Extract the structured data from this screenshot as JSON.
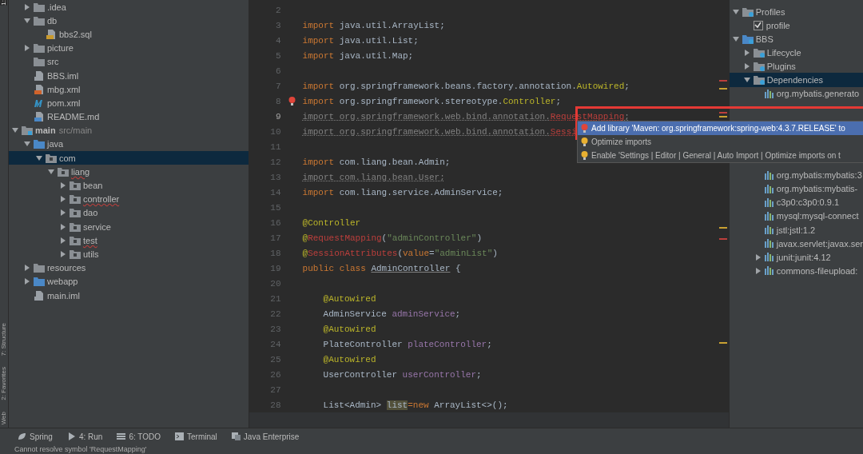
{
  "left_stripe": [
    {
      "label": "1:",
      "selected": true
    },
    {
      "label": "7: Structure",
      "selected": false
    },
    {
      "label": "2: Favorites",
      "selected": false
    },
    {
      "label": "Web",
      "selected": false
    }
  ],
  "project_tree": {
    "upper_items": [
      {
        "label": ".idea",
        "kind": "folder",
        "expanded": false,
        "selected": false
      },
      {
        "label": "db",
        "kind": "folder",
        "expanded": true,
        "selected": false,
        "children": [
          {
            "label": "bbs2.sql",
            "kind": "sql",
            "selected": false
          }
        ]
      },
      {
        "label": "picture",
        "kind": "folder",
        "expanded": false,
        "selected": false
      },
      {
        "label": "src",
        "kind": "folder",
        "selected": false
      },
      {
        "label": "BBS.iml",
        "kind": "iml",
        "selected": false
      },
      {
        "label": "mbg.xml",
        "kind": "xml",
        "selected": false
      },
      {
        "label": "pom.xml",
        "kind": "maven",
        "selected": false
      },
      {
        "label": "README.md",
        "kind": "md",
        "selected": false
      }
    ],
    "items": [
      {
        "label": "main",
        "note": "src/main",
        "kind": "module",
        "expanded": true,
        "selected": false,
        "children": [
          {
            "label": "java",
            "kind": "source",
            "expanded": true,
            "selected": false,
            "children": [
              {
                "label": "com",
                "kind": "package",
                "expanded": true,
                "selected": true,
                "children": [
                  {
                    "label": "liang",
                    "kind": "package",
                    "expanded": true,
                    "selected": false,
                    "error": true,
                    "children": [
                      {
                        "label": "bean",
                        "kind": "package",
                        "expanded": false,
                        "selected": false,
                        "error": false
                      },
                      {
                        "label": "controller",
                        "kind": "package",
                        "expanded": false,
                        "selected": false,
                        "error": true
                      },
                      {
                        "label": "dao",
                        "kind": "package",
                        "expanded": false,
                        "selected": false,
                        "error": false
                      },
                      {
                        "label": "service",
                        "kind": "package",
                        "expanded": false,
                        "selected": false,
                        "error": false
                      },
                      {
                        "label": "test",
                        "kind": "package",
                        "expanded": false,
                        "selected": false,
                        "error": true
                      },
                      {
                        "label": "utils",
                        "kind": "package",
                        "expanded": false,
                        "selected": false,
                        "error": false
                      }
                    ]
                  }
                ]
              }
            ]
          },
          {
            "label": "resources",
            "kind": "folder",
            "expanded": false,
            "selected": false
          },
          {
            "label": "webapp",
            "kind": "web",
            "expanded": false,
            "selected": false
          },
          {
            "label": "main.iml",
            "kind": "iml",
            "selected": false
          }
        ]
      }
    ]
  },
  "editor": {
    "lines": [
      {
        "number": "2"
      },
      {
        "number": "3",
        "code": [
          {
            "t": "import",
            "kind": "keyword"
          },
          {
            "t": " java.util.ArrayList;",
            "kind": "plain"
          }
        ]
      },
      {
        "number": "4",
        "code": [
          {
            "t": "import",
            "kind": "keyword"
          },
          {
            "t": " java.util.List;",
            "kind": "plain"
          }
        ]
      },
      {
        "number": "5",
        "code": [
          {
            "t": "import",
            "kind": "keyword"
          },
          {
            "t": " java.util.Map;",
            "kind": "plain"
          }
        ]
      },
      {
        "number": "6"
      },
      {
        "number": "7",
        "code": [
          {
            "t": "import",
            "kind": "keyword"
          },
          {
            "t": " org.springframework.beans.factory.annotation.",
            "kind": "plain"
          },
          {
            "t": "Autowired",
            "kind": "annotation"
          },
          {
            "t": ";",
            "kind": "plain"
          }
        ]
      },
      {
        "number": "8",
        "bulb": true,
        "code": [
          {
            "t": "import",
            "kind": "keyword"
          },
          {
            "t": " org.springframework.stereotype.",
            "kind": "plain"
          },
          {
            "t": "Controller",
            "kind": "annotation"
          },
          {
            "t": ";",
            "kind": "plain"
          }
        ]
      },
      {
        "number": "9",
        "current": true,
        "code": [
          {
            "t": "import org.springframework.web.bind.annotation.",
            "kind": "unused"
          },
          {
            "t": "RequestMapping",
            "kind": "unresolved"
          },
          {
            "t": ";",
            "kind": "unused"
          }
        ]
      },
      {
        "number": "10",
        "code": [
          {
            "t": "import org.springframework.web.bind.annotation.",
            "kind": "unused"
          },
          {
            "t": "Sessi",
            "kind": "unresolved"
          }
        ]
      },
      {
        "number": "11"
      },
      {
        "number": "12",
        "code": [
          {
            "t": "import",
            "kind": "keyword"
          },
          {
            "t": " com.liang.bean.Admin;",
            "kind": "plain"
          }
        ]
      },
      {
        "number": "13",
        "code": [
          {
            "t": "import com.liang.bean.User;",
            "kind": "unused"
          }
        ]
      },
      {
        "number": "14",
        "code": [
          {
            "t": "import",
            "kind": "keyword"
          },
          {
            "t": " com.liang.service.AdminService;",
            "kind": "plain"
          }
        ]
      },
      {
        "number": "15"
      },
      {
        "number": "16",
        "code": [
          {
            "t": "@Controller",
            "kind": "annotation"
          }
        ]
      },
      {
        "number": "17",
        "code": [
          {
            "t": "@",
            "kind": "annotation"
          },
          {
            "t": "RequestMapping",
            "kind": "error"
          },
          {
            "t": "(",
            "kind": "plain"
          },
          {
            "t": "\"adminController\"",
            "kind": "string"
          },
          {
            "t": ")",
            "kind": "plain"
          }
        ]
      },
      {
        "number": "18",
        "code": [
          {
            "t": "@",
            "kind": "annotation"
          },
          {
            "t": "SessionAttributes",
            "kind": "error"
          },
          {
            "t": "(",
            "kind": "plain"
          },
          {
            "t": "value",
            "kind": "keyword"
          },
          {
            "t": "=",
            "kind": "plain"
          },
          {
            "t": "\"adminList\"",
            "kind": "string"
          },
          {
            "t": ")",
            "kind": "plain"
          }
        ]
      },
      {
        "number": "19",
        "code": [
          {
            "t": "public class ",
            "kind": "keyword"
          },
          {
            "t": "AdminController",
            "kind": "underlined"
          },
          {
            "t": " {",
            "kind": "plain"
          }
        ]
      },
      {
        "number": "20"
      },
      {
        "number": "21",
        "indented": true,
        "code": [
          {
            "t": "@Autowired",
            "kind": "annotation"
          }
        ]
      },
      {
        "number": "22",
        "indented": true,
        "code": [
          {
            "t": "AdminService ",
            "kind": "plain"
          },
          {
            "t": "adminService",
            "kind": "field"
          },
          {
            "t": ";",
            "kind": "plain"
          }
        ]
      },
      {
        "number": "23",
        "indented": true,
        "code": [
          {
            "t": "@Autowired",
            "kind": "annotation"
          }
        ]
      },
      {
        "number": "24",
        "indented": true,
        "code": [
          {
            "t": "PlateController ",
            "kind": "plain"
          },
          {
            "t": "plateController",
            "kind": "field"
          },
          {
            "t": ";",
            "kind": "plain"
          }
        ]
      },
      {
        "number": "25",
        "indented": true,
        "code": [
          {
            "t": "@Autowired",
            "kind": "annotation"
          }
        ]
      },
      {
        "number": "26",
        "indented": true,
        "code": [
          {
            "t": "UserController ",
            "kind": "plain"
          },
          {
            "t": "userController",
            "kind": "field"
          },
          {
            "t": ";",
            "kind": "plain"
          }
        ]
      },
      {
        "number": "27"
      },
      {
        "number": "28",
        "indented": true,
        "code": [
          {
            "t": "List<Admin> ",
            "kind": "plain"
          },
          {
            "t": "list",
            "kind": "highlight"
          },
          {
            "t": "=new",
            "kind": "keyword"
          },
          {
            "t": " ArrayList<>();",
            "kind": "plain"
          }
        ]
      }
    ]
  },
  "intention_popup": {
    "items": [
      {
        "label": "Add library 'Maven: org.springframework:spring-web:4.3.7.RELEASE' to",
        "kind": "fix",
        "selected": true
      },
      {
        "label": "Optimize imports",
        "kind": "intention",
        "selected": false
      },
      {
        "label": "Enable 'Settings | Editor | General | Auto Import | Optimize imports on t",
        "kind": "intention",
        "selected": false
      }
    ]
  },
  "maven_tree": {
    "items": [
      {
        "label": "Profiles",
        "kind": "profiles",
        "expanded": true,
        "selected": false,
        "children": [
          {
            "label": "profile",
            "kind": "checkbox",
            "checked": true,
            "selected": false
          }
        ]
      },
      {
        "label": "BBS",
        "kind": "project",
        "expanded": true,
        "selected": false,
        "children": [
          {
            "label": "Lifecycle",
            "kind": "group",
            "expanded": false,
            "selected": false
          },
          {
            "label": "Plugins",
            "kind": "group",
            "expanded": false,
            "selected": false
          },
          {
            "label": "Dependencies",
            "kind": "deps",
            "expanded": true,
            "selected": true,
            "children": [
              {
                "label": "org.mybatis.generato",
                "kind": "library",
                "selected": false
              },
              {
                "label": "org.mybatis:mybatis:3",
                "kind": "library",
                "selected": false
              },
              {
                "label": "org.mybatis:mybatis-",
                "kind": "library",
                "selected": false
              },
              {
                "label": "c3p0:c3p0:0.9.1",
                "kind": "library",
                "selected": false
              },
              {
                "label": "mysql:mysql-connect",
                "kind": "library",
                "selected": false
              },
              {
                "label": "jstl:jstl:1.2",
                "kind": "library",
                "selected": false
              },
              {
                "label": "javax.servlet:javax.ser",
                "kind": "library",
                "selected": false
              },
              {
                "label": "junit:junit:4.12",
                "kind": "library",
                "expanded": false,
                "selected": false
              },
              {
                "label": "commons-fileupload:",
                "kind": "library",
                "expanded": false,
                "selected": false
              }
            ]
          }
        ]
      }
    ]
  },
  "bottom_tools": [
    {
      "label": "Spring",
      "kind": "spring"
    },
    {
      "label": "4: Run",
      "kind": "run"
    },
    {
      "label": "6: TODO",
      "kind": "todo"
    },
    {
      "label": "Terminal",
      "kind": "terminal"
    },
    {
      "label": "Java Enterprise",
      "kind": "enterprise"
    }
  ],
  "status_bar": {
    "message": "Cannot resolve symbol 'RequestMapping'"
  }
}
